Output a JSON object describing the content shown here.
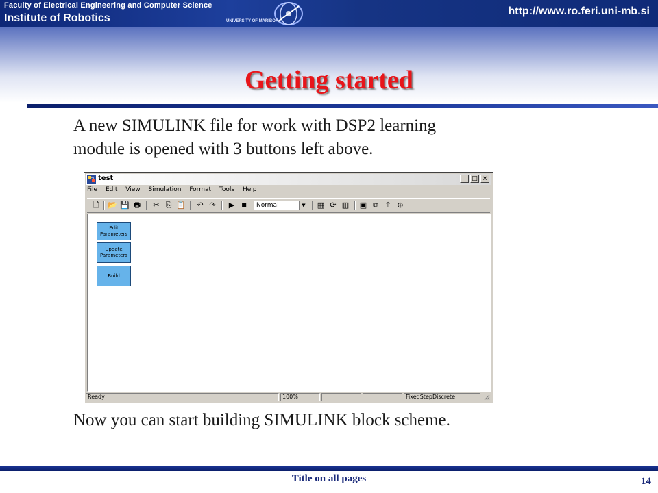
{
  "header": {
    "faculty": "Faculty of Electrical Engineering and Computer Science",
    "institute": "Institute of Robotics",
    "university": "UNIVERSITY OF MARIBOR",
    "url": "http://www.ro.feri.uni-mb.si"
  },
  "slide": {
    "title": "Getting started",
    "paragraph1_line1": "A new SIMULINK file for work with DSP2 learning",
    "paragraph1_line2": "module is opened with 3 buttons left above.",
    "paragraph2": "Now you can start building SIMULINK block scheme."
  },
  "window": {
    "title": "test",
    "controls": {
      "minimize": "_",
      "maximize": "□",
      "close": "×"
    },
    "menu": [
      "File",
      "Edit",
      "View",
      "Simulation",
      "Format",
      "Tools",
      "Help"
    ],
    "toolbar": {
      "new": "🗋",
      "open": "📂",
      "save": "💾",
      "print": "🖶",
      "cut": "✂",
      "copy": "⎘",
      "paste": "📋",
      "undo": "↶",
      "redo": "↷",
      "start": "▶",
      "stop": "■",
      "sim_mode": "Normal",
      "sim_mode_arrow": "▼",
      "build": "▦",
      "update": "⟳",
      "library": "▥",
      "model_browser": "▣",
      "debug": "⧉",
      "up": "⇧",
      "help": "⊕"
    },
    "blocks": [
      {
        "line1": "Edit",
        "line2": "Parameters"
      },
      {
        "line1": "Update",
        "line2": "Parameters"
      },
      {
        "line1": "Build",
        "line2": ""
      }
    ],
    "status": {
      "ready": "Ready",
      "zoom": "100%",
      "solver": "FixedStepDiscrete"
    }
  },
  "footer": {
    "text": "Title on all pages",
    "page_number": "14"
  }
}
